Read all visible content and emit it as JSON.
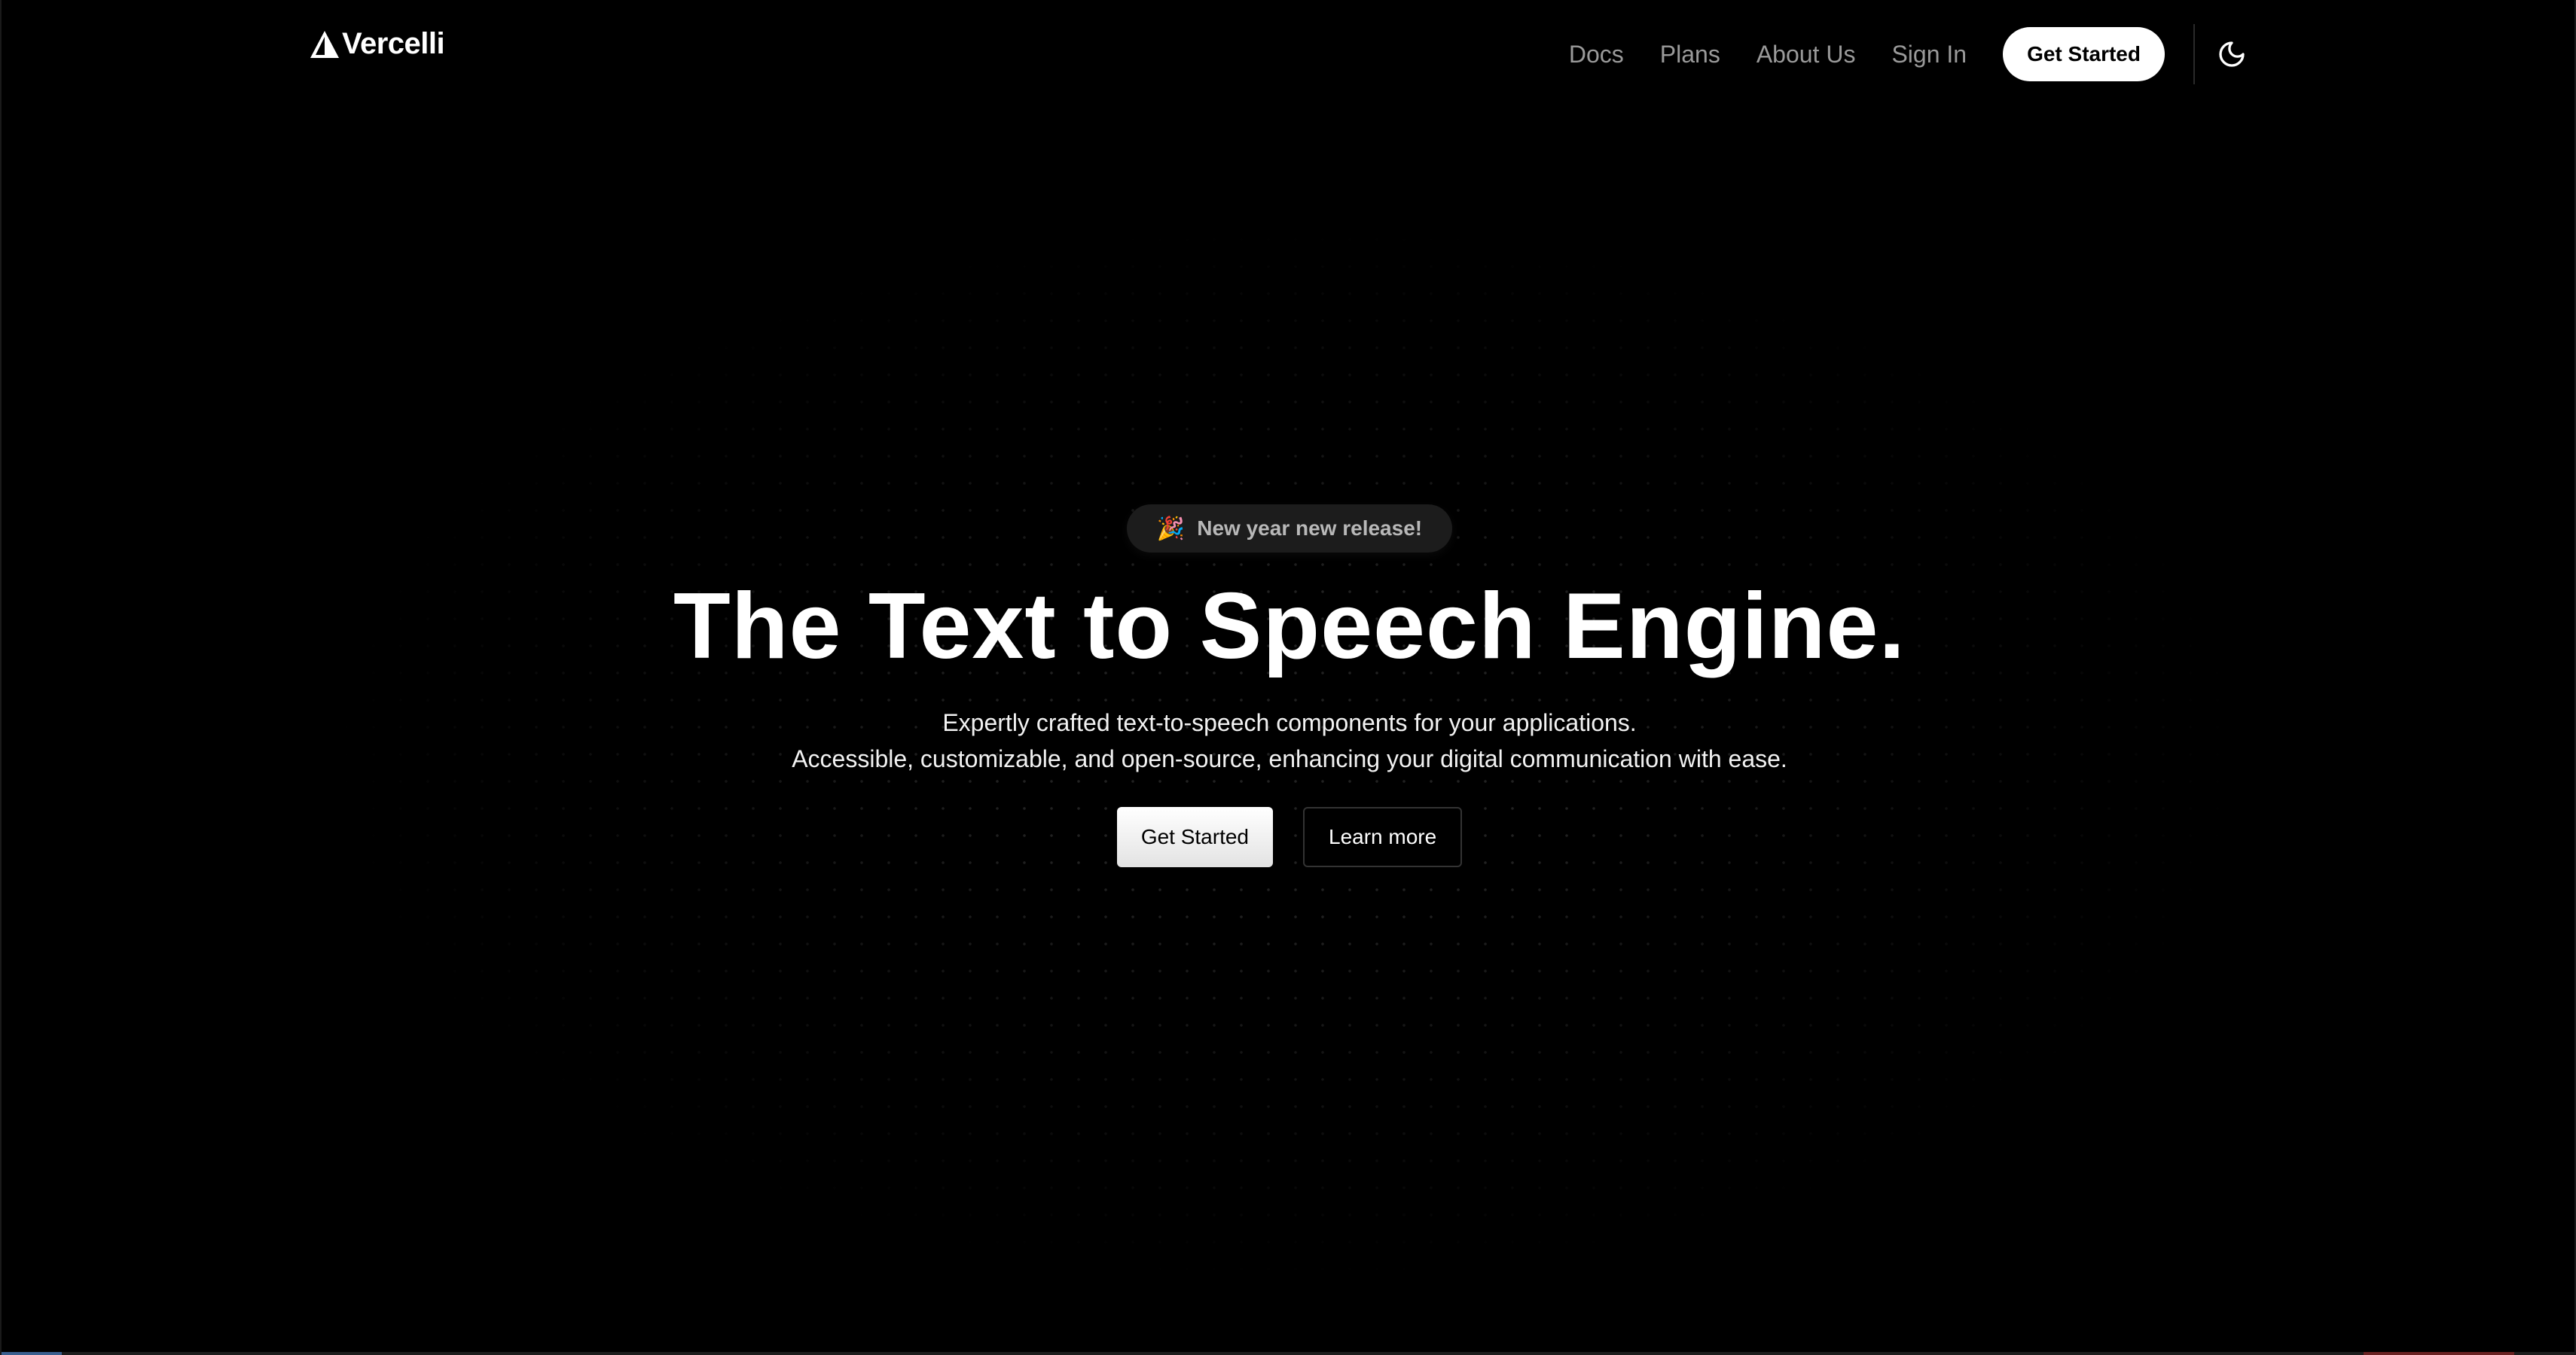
{
  "header": {
    "logo_text": "Vercelli",
    "nav": [
      {
        "label": "Docs"
      },
      {
        "label": "Plans"
      },
      {
        "label": "About Us"
      },
      {
        "label": "Sign In"
      }
    ],
    "cta_label": "Get Started",
    "theme_toggle_icon": "moon-icon"
  },
  "hero": {
    "badge": {
      "emoji": "🎉",
      "label": "New year new release!"
    },
    "headline": "The Text to Speech Engine.",
    "subtext_line1": "Expertly crafted text-to-speech components for your applications.",
    "subtext_line2": "Accessible, customizable, and open-source, enhancing your digital communication with ease.",
    "primary_button": "Get Started",
    "secondary_button": "Learn more"
  },
  "colors": {
    "background": "#000000",
    "text_primary": "#ffffff",
    "nav_text": "#9a9a9a",
    "badge_bg": "#1c1c1c"
  }
}
